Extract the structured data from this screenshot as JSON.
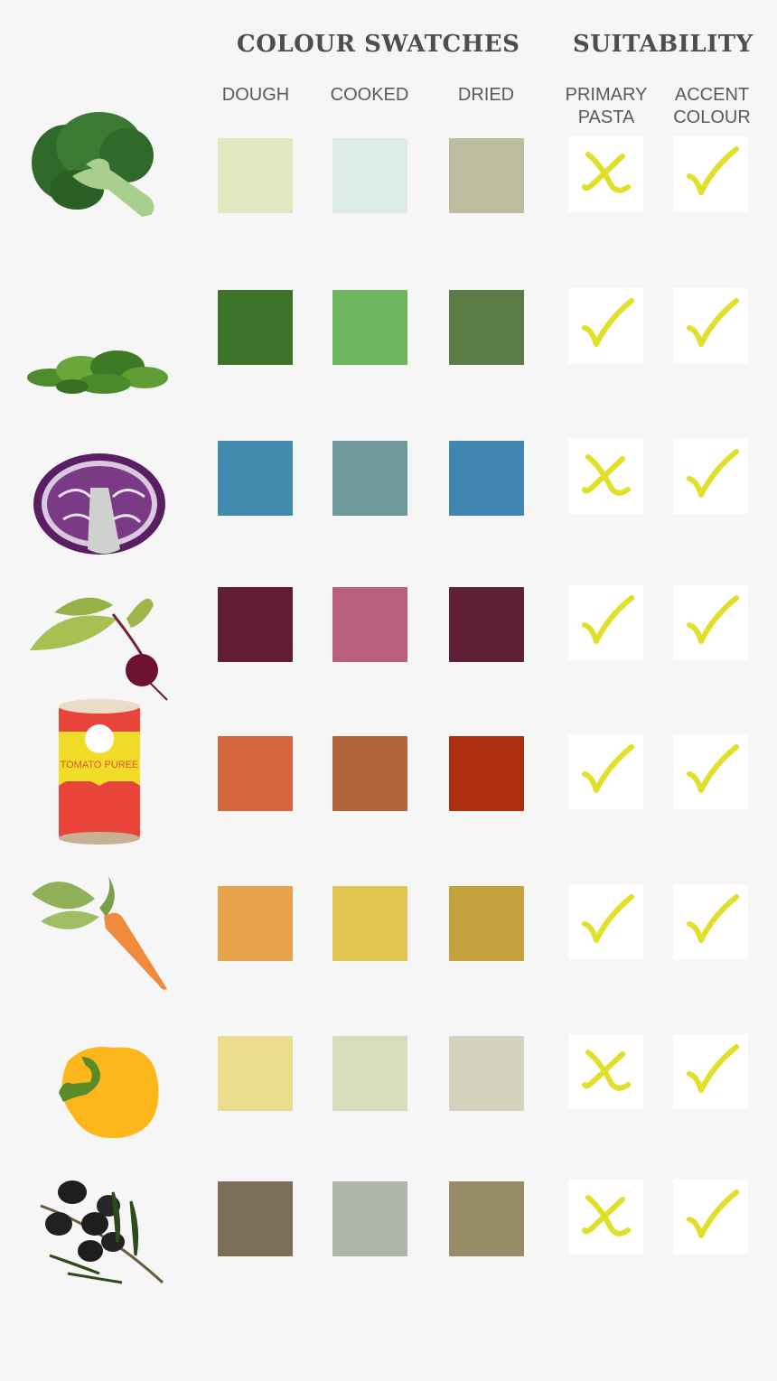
{
  "headers": {
    "swatches_group": "COLOUR SWATCHES",
    "suitability_group": "SUITABILITY",
    "dough": "DOUGH",
    "cooked": "COOKED",
    "dried": "DRIED",
    "primary_pasta": "PRIMARY\nPASTA",
    "accent_colour": "ACCENT\nCOLOUR"
  },
  "mark_color": "#e0e02a",
  "rows": [
    {
      "icon": "broccoli-icon",
      "dough": "#e1e8bf",
      "cooked": "#ddede5",
      "dried": "#bcbc9f",
      "primary": "cross",
      "accent": "check"
    },
    {
      "icon": "spinach-icon",
      "dough": "#3c7229",
      "cooked": "#6eb55d",
      "dried": "#5c7c47",
      "primary": "check",
      "accent": "check"
    },
    {
      "icon": "red-cabbage-icon",
      "dough": "#438aaf",
      "cooked": "#6d999d",
      "dried": "#4086b1",
      "primary": "cross",
      "accent": "check"
    },
    {
      "icon": "beetroot-icon",
      "dough": "#611d34",
      "cooked": "#ba607d",
      "dried": "#5f2133",
      "primary": "check",
      "accent": "check"
    },
    {
      "icon": "tomato-puree-can-icon",
      "label": "TOMATO PUREE",
      "dough": "#d5653d",
      "cooked": "#b3643d",
      "dried": "#ad2f10",
      "primary": "check",
      "accent": "check"
    },
    {
      "icon": "carrot-icon",
      "dough": "#e8a44c",
      "cooked": "#e1c551",
      "dried": "#c6a23f",
      "primary": "check",
      "accent": "check"
    },
    {
      "icon": "yellow-pepper-icon",
      "dough": "#eadd8e",
      "cooked": "#d8dcbd",
      "dried": "#d3d3bd",
      "primary": "cross",
      "accent": "check"
    },
    {
      "icon": "olives-icon",
      "dough": "#7b6f57",
      "cooked": "#b0b5aa",
      "dried": "#988c68",
      "primary": "cross",
      "accent": "check"
    }
  ]
}
